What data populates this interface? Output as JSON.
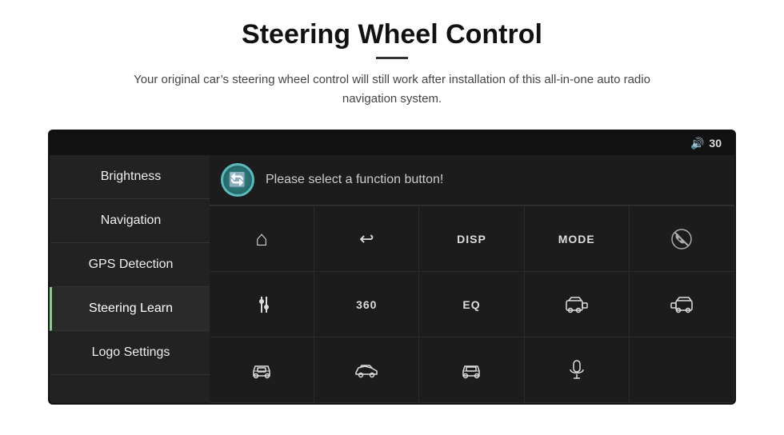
{
  "header": {
    "title": "Steering Wheel Control",
    "divider": true,
    "subtitle": "Your original car’s steering wheel control will still work after installation of this all-in-one auto radio navigation system."
  },
  "device": {
    "topbar": {
      "volume_icon": "🔊",
      "volume_value": "30"
    },
    "sidebar": {
      "items": [
        {
          "id": "brightness",
          "label": "Brightness",
          "active": false
        },
        {
          "id": "navigation",
          "label": "Navigation",
          "active": false
        },
        {
          "id": "gps-detection",
          "label": "GPS Detection",
          "active": false
        },
        {
          "id": "steering-learn",
          "label": "Steering Learn",
          "active": true
        },
        {
          "id": "logo-settings",
          "label": "Logo Settings",
          "active": false
        }
      ]
    },
    "content": {
      "sync_button_label": "sync",
      "prompt": "Please select a function button!",
      "grid": [
        [
          {
            "type": "house",
            "label": ""
          },
          {
            "type": "back",
            "label": ""
          },
          {
            "type": "text",
            "label": "DISP"
          },
          {
            "type": "text",
            "label": "MODE"
          },
          {
            "type": "phone-cancel",
            "label": ""
          }
        ],
        [
          {
            "type": "sliders",
            "label": ""
          },
          {
            "type": "text",
            "label": "360"
          },
          {
            "type": "text",
            "label": "EQ"
          },
          {
            "type": "car-beer",
            "label": ""
          },
          {
            "type": "car-beer2",
            "label": ""
          }
        ],
        [
          {
            "type": "car-front",
            "label": ""
          },
          {
            "type": "car-side",
            "label": ""
          },
          {
            "type": "car-rear",
            "label": ""
          },
          {
            "type": "mic",
            "label": ""
          },
          {
            "type": "empty",
            "label": ""
          }
        ]
      ]
    }
  }
}
